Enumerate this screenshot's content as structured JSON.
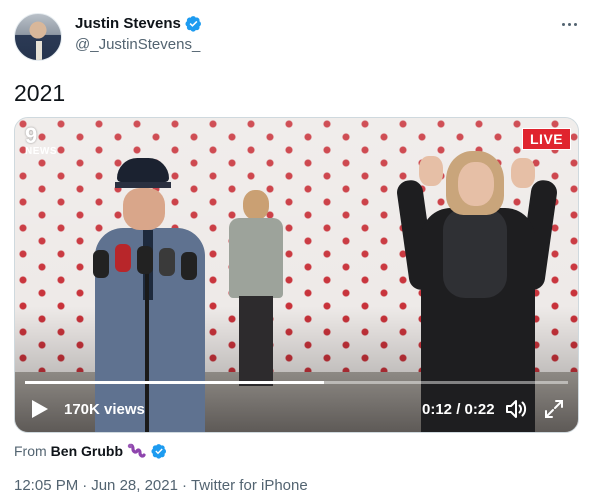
{
  "author": {
    "name": "Justin Stevens",
    "handle": "@_JustinStevens_",
    "verified": true
  },
  "tweet": {
    "text": "2021"
  },
  "video": {
    "channel_logo": "9",
    "channel_logo_sub": "NEWS",
    "live_badge": "LIVE",
    "views": "170K views",
    "time": "0:12 / 0:22",
    "progress_fraction": 0.55,
    "icons": [
      "play-icon",
      "volume-icon",
      "expand-icon"
    ]
  },
  "attribution": {
    "prefix": "From",
    "name": "Ben Grubb",
    "emoji": "worm",
    "verified": true
  },
  "meta": {
    "time": "12:05 PM",
    "separator1": "·",
    "date": "Jun 28, 2021",
    "separator2": "·",
    "source": "Twitter for iPhone"
  },
  "colors": {
    "verified_blue": "#1d9bf0",
    "live_red": "#e0242e",
    "secondary_text": "#536471",
    "primary_text": "#0f1419"
  }
}
